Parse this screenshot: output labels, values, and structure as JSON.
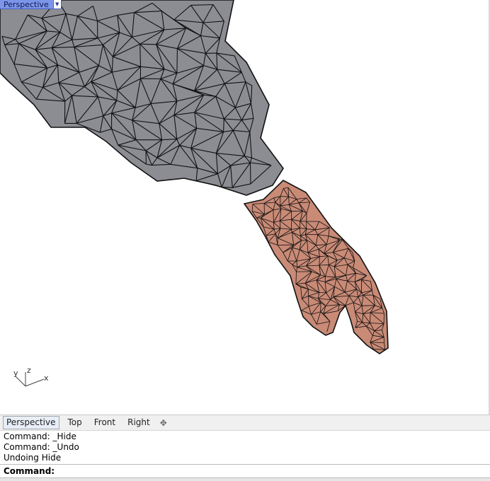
{
  "viewport": {
    "label": "Perspective",
    "colors": {
      "background": "#ffffff",
      "sleeve_fill": "#8c8d93",
      "hand_fill": "#c98a76",
      "wire": "#111111",
      "label_bg": "#7d95e8"
    },
    "dropdown_icon": "triangle-down-icon"
  },
  "axis_gizmo": {
    "x": "x",
    "y": "y",
    "z": "z"
  },
  "tabs": [
    {
      "label": "Perspective",
      "active": true
    },
    {
      "label": "Top",
      "active": false
    },
    {
      "label": "Front",
      "active": false
    },
    {
      "label": "Right",
      "active": false
    }
  ],
  "add_tab_icon": "plus-icon",
  "command_history": [
    "Command: _Hide",
    "Command: _Undo",
    "Undoing Hide"
  ],
  "command_prompt": "Command:",
  "command_value": ""
}
